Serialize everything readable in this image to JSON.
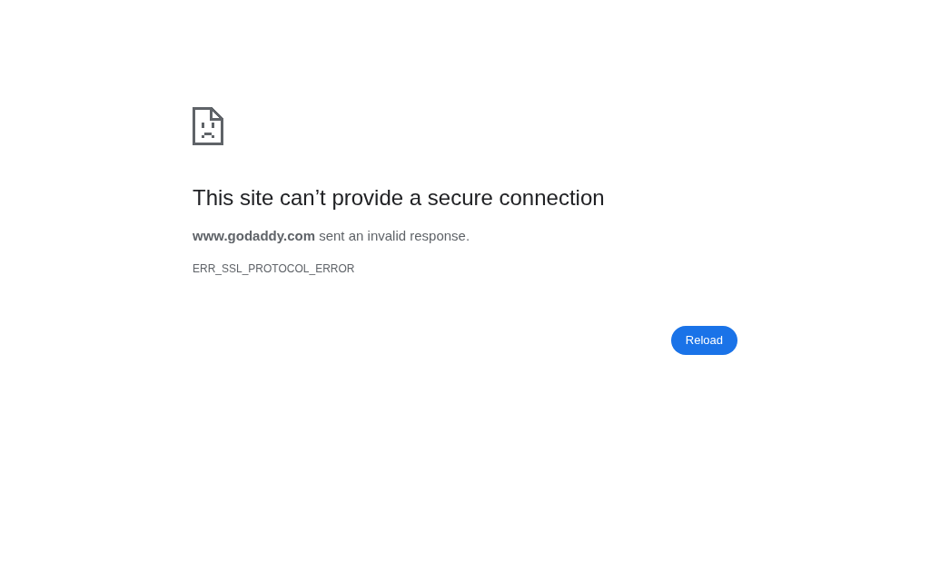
{
  "error_page": {
    "heading": "This site can’t provide a secure connection",
    "message": "**www.godaddy.com** sent an invalid response.",
    "error_code": "ERR_SSL_PROTOCOL_ERROR",
    "buttons": [
      {
        "label": "Reload"
      }
    ]
  }
}
